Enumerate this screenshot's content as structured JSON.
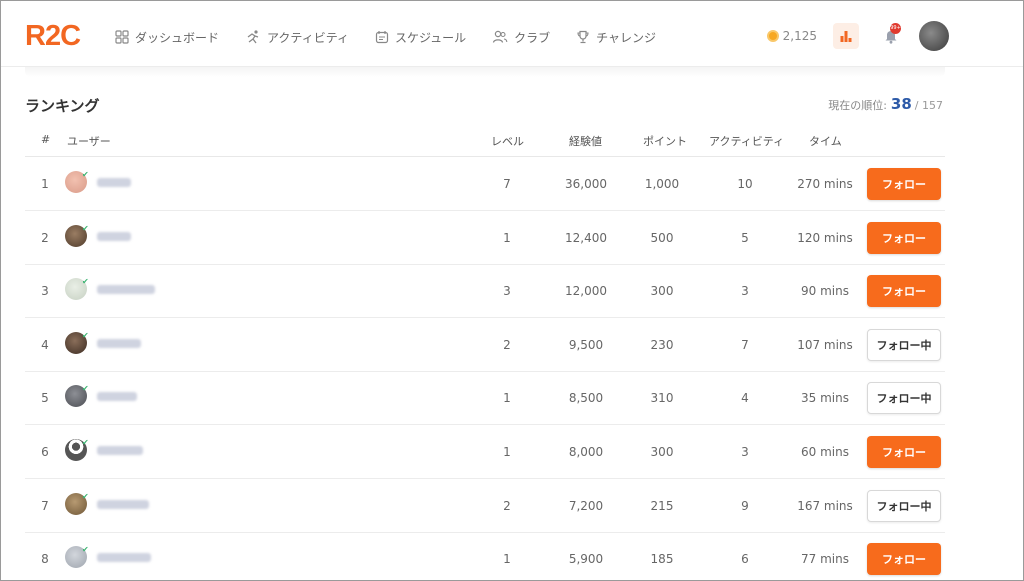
{
  "app": {
    "logo": "R2C"
  },
  "nav": [
    {
      "label": "ダッシュボード",
      "icon": "grid-icon"
    },
    {
      "label": "アクティビティ",
      "icon": "runner-icon"
    },
    {
      "label": "スケジュール",
      "icon": "calendar-icon"
    },
    {
      "label": "クラブ",
      "icon": "people-icon"
    },
    {
      "label": "チャレンジ",
      "icon": "trophy-icon"
    }
  ],
  "header": {
    "coins": "2,125",
    "notification_badge": "99+"
  },
  "ranking": {
    "title": "ランキング",
    "current_rank_label": "現在の順位:",
    "current_rank": "38",
    "total": "/ 157",
    "columns": {
      "rank": "#",
      "user": "ユーザー",
      "level": "レベル",
      "exp": "経験値",
      "points": "ポイント",
      "activities": "アクティビティ",
      "time": "タイム"
    },
    "rows": [
      {
        "rank": "1",
        "level": "7",
        "exp": "36,000",
        "points": "1,000",
        "activities": "10",
        "time": "270 mins",
        "button": "フォロー"
      },
      {
        "rank": "2",
        "level": "1",
        "exp": "12,400",
        "points": "500",
        "activities": "5",
        "time": "120 mins",
        "button": "フォロー"
      },
      {
        "rank": "3",
        "level": "3",
        "exp": "12,000",
        "points": "300",
        "activities": "3",
        "time": "90 mins",
        "button": "フォロー"
      },
      {
        "rank": "4",
        "level": "2",
        "exp": "9,500",
        "points": "230",
        "activities": "7",
        "time": "107 mins",
        "button": "フォロー中"
      },
      {
        "rank": "5",
        "level": "1",
        "exp": "8,500",
        "points": "310",
        "activities": "4",
        "time": "35 mins",
        "button": "フォロー中"
      },
      {
        "rank": "6",
        "level": "1",
        "exp": "8,000",
        "points": "300",
        "activities": "3",
        "time": "60 mins",
        "button": "フォロー"
      },
      {
        "rank": "7",
        "level": "2",
        "exp": "7,200",
        "points": "215",
        "activities": "9",
        "time": "167 mins",
        "button": "フォロー中"
      },
      {
        "rank": "8",
        "level": "1",
        "exp": "5,900",
        "points": "185",
        "activities": "6",
        "time": "77 mins",
        "button": "フォロー"
      }
    ]
  },
  "colors": {
    "brand": "#f26722",
    "follow_button": "#f76b1c",
    "rank_number": "#2d5aa8"
  }
}
